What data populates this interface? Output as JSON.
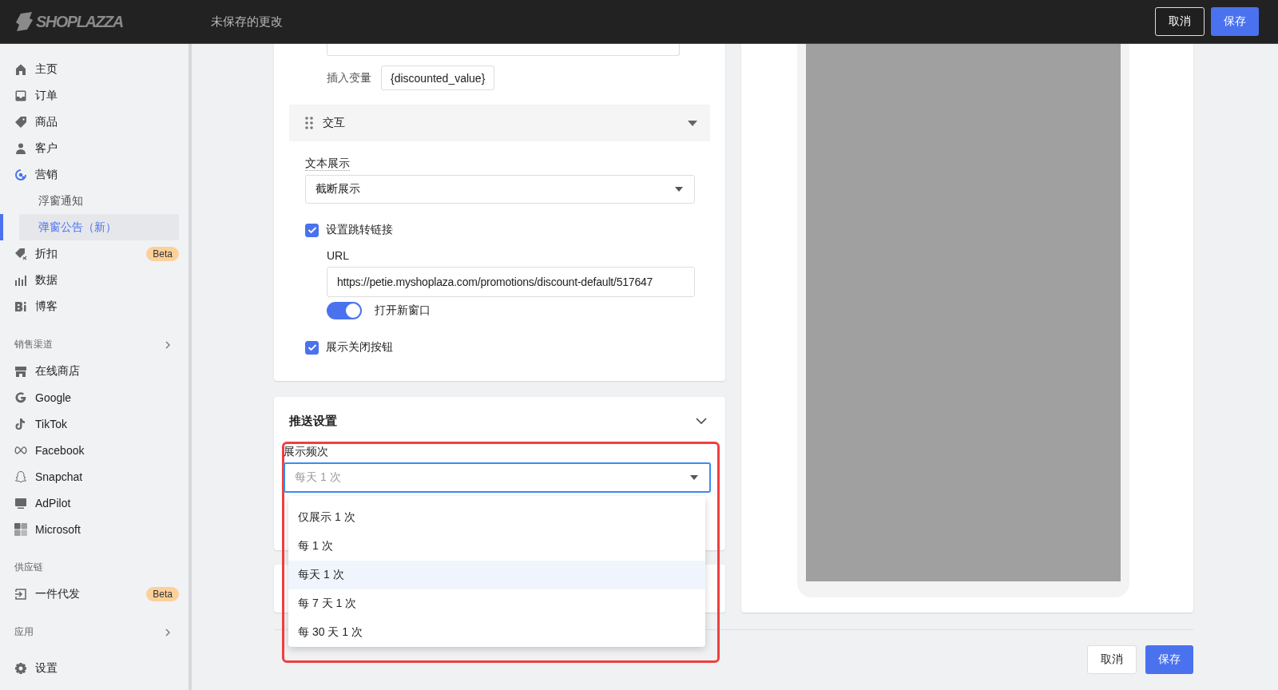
{
  "topbar": {
    "logo": "SHOPLAZZA",
    "title": "未保存的更改",
    "cancel": "取消",
    "save": "保存"
  },
  "sidebar": {
    "items": [
      {
        "kind": "nav",
        "label": "主页",
        "selected": false
      },
      {
        "kind": "nav",
        "label": "订单",
        "selected": false
      },
      {
        "kind": "nav",
        "label": "商品",
        "selected": false
      },
      {
        "kind": "nav",
        "label": "客户",
        "selected": false
      },
      {
        "kind": "nav",
        "label": "营销",
        "selected": true
      },
      {
        "kind": "sub",
        "label": "浮窗通知",
        "selected": false
      },
      {
        "kind": "sub",
        "label": "弹窗公告（新）",
        "selected": true
      },
      {
        "kind": "nav",
        "label": "折扣",
        "selected": false,
        "badge": "Beta"
      },
      {
        "kind": "nav",
        "label": "数据",
        "selected": false
      },
      {
        "kind": "nav",
        "label": "博客",
        "selected": false
      },
      {
        "kind": "section",
        "label": "销售渠道",
        "expandable": true
      },
      {
        "kind": "nav",
        "label": "在线商店",
        "selected": false
      },
      {
        "kind": "nav",
        "label": "Google",
        "selected": false
      },
      {
        "kind": "nav",
        "label": "TikTok",
        "selected": false
      },
      {
        "kind": "nav",
        "label": "Facebook",
        "selected": false
      },
      {
        "kind": "nav",
        "label": "Snapchat",
        "selected": false
      },
      {
        "kind": "nav",
        "label": "AdPilot",
        "selected": false
      },
      {
        "kind": "nav",
        "label": "Microsoft",
        "selected": false
      },
      {
        "kind": "section",
        "label": "供应链",
        "expandable": false
      },
      {
        "kind": "nav",
        "label": "一件代发",
        "selected": false,
        "badge": "Beta"
      },
      {
        "kind": "section",
        "label": "应用",
        "expandable": true
      },
      {
        "kind": "nav",
        "label": "设置",
        "selected": false
      }
    ]
  },
  "content_card": {
    "insert_variable": {
      "label": "插入变量",
      "chip": "{discounted_value}"
    },
    "interaction": {
      "title": "交互",
      "expanded": true,
      "text_display": {
        "label": "文本展示",
        "value": "截断展示"
      },
      "link": {
        "label": "设置跳转链接",
        "checked": true
      },
      "url": {
        "label": "URL",
        "value": "https://petie.myshoplaza.com/promotions/discount-default/517647"
      },
      "new_window": {
        "label": "打开新窗口",
        "on": true
      },
      "close_button": {
        "label": "展示关闭按钮",
        "checked": true
      }
    }
  },
  "push_settings": {
    "title": "推送设置",
    "frequency": {
      "label": "展示频次",
      "value": "每天 1 次",
      "open": true,
      "options": [
        {
          "label": "仅展示 1 次",
          "selected": false
        },
        {
          "label": "每 1 次",
          "selected": false
        },
        {
          "label": "每天 1 次",
          "selected": true
        },
        {
          "label": "每 7 天 1 次",
          "selected": false
        },
        {
          "label": "每 30 天 1 次",
          "selected": false
        }
      ]
    }
  },
  "footer": {
    "cancel": "取消",
    "save": "保存"
  }
}
